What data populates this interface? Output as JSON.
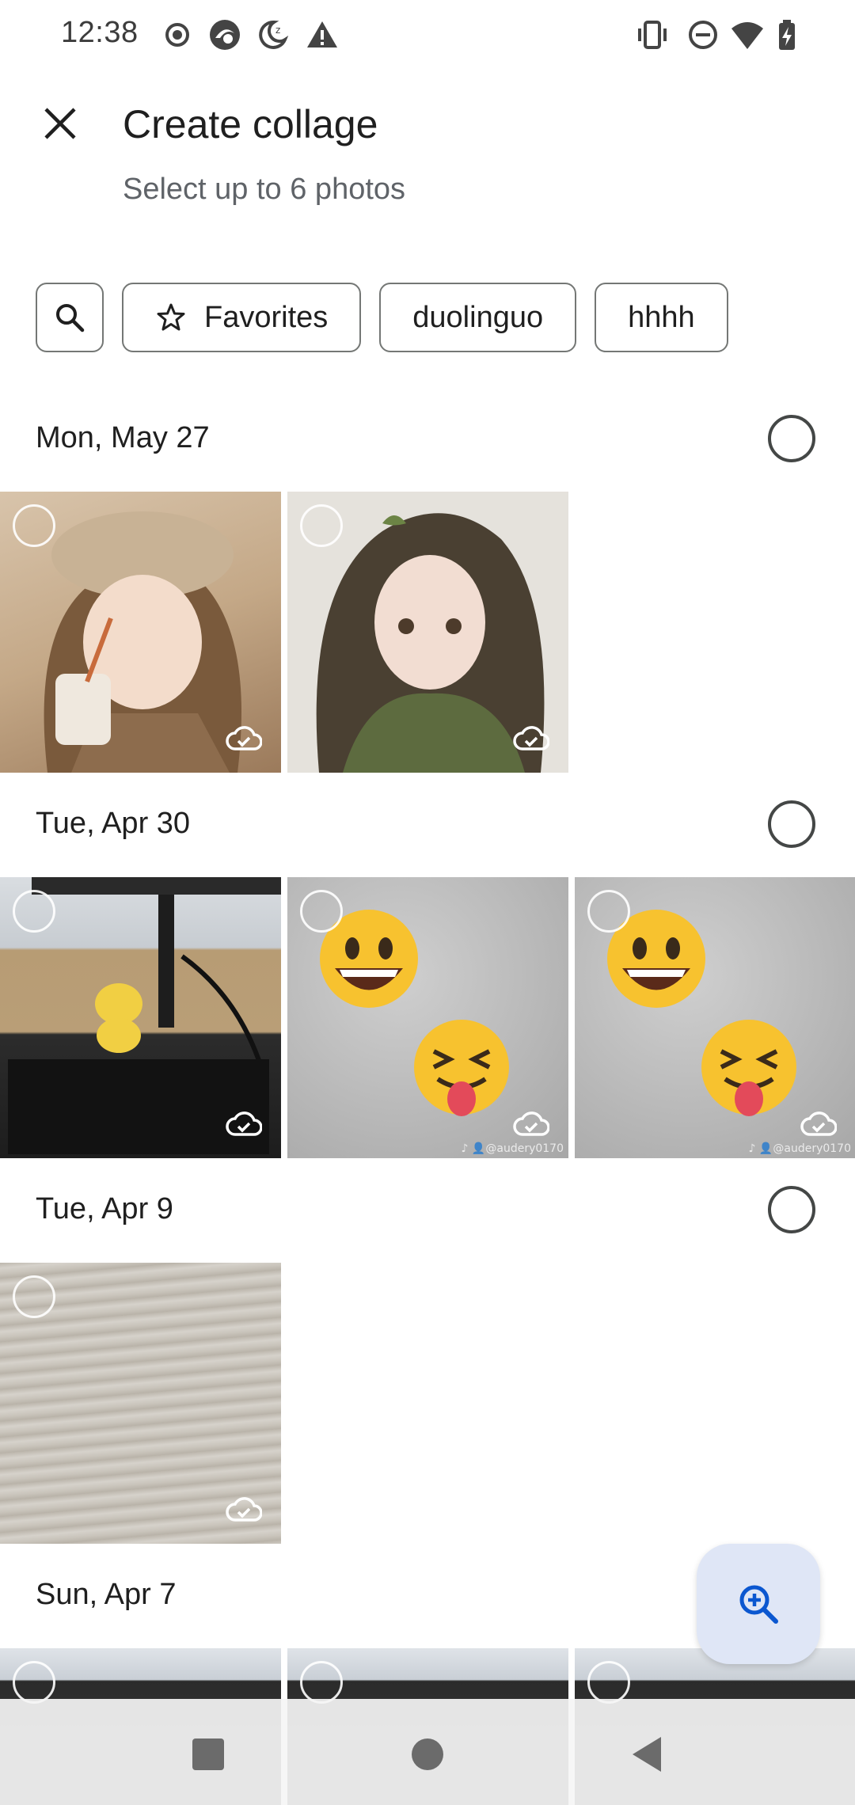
{
  "status_bar": {
    "time": "12:38",
    "left_icons": [
      "record-icon",
      "app-icon",
      "do-not-disturb-moon-icon",
      "warning-icon"
    ],
    "right_icons": [
      "vibrate-icon",
      "dnd-icon",
      "wifi-icon",
      "battery-charging-icon"
    ]
  },
  "header": {
    "title": "Create collage",
    "subtitle": "Select up to 6 photos"
  },
  "chips": {
    "search_icon": "search-icon",
    "favorites": "Favorites",
    "chip2": "duolinguo",
    "chip3": "hhhh"
  },
  "sections": [
    {
      "date": "Mon, May 27",
      "photos": [
        "girl-with-coffee",
        "girl-green-sweater"
      ]
    },
    {
      "date": "Tue, Apr 30",
      "photos": [
        "desk-keyboard",
        "emoji-faces",
        "emoji-faces"
      ]
    },
    {
      "date": "Tue, Apr 9",
      "photos": [
        "wood-surface"
      ]
    },
    {
      "date": "Sun, Apr 7",
      "photos": [
        "monitor",
        "monitor",
        "monitor"
      ]
    }
  ],
  "watermark": "♪ 👤@audery0170",
  "fab": {
    "icon": "zoom-in-icon"
  },
  "nav": {
    "icons": [
      "recents-square-icon",
      "home-circle-icon",
      "back-triangle-icon"
    ]
  },
  "colors": {
    "accent": "#0b57d0",
    "fab_bg": "#dfe6f6"
  }
}
